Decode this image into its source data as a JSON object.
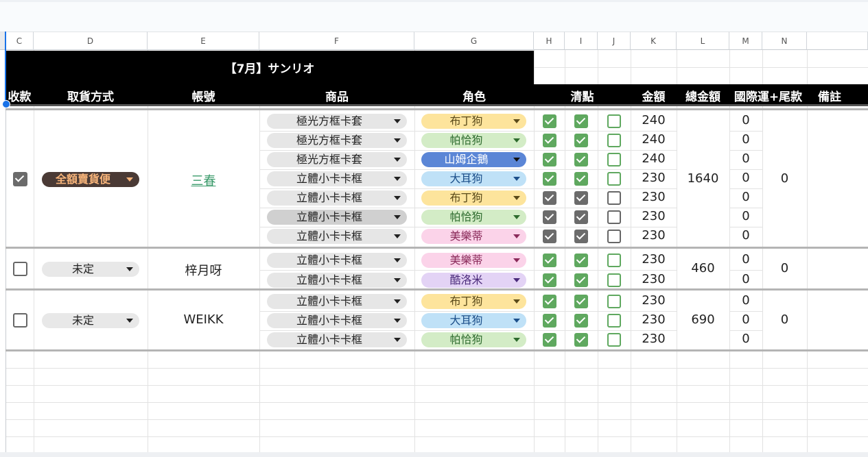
{
  "columns": [
    "C",
    "D",
    "E",
    "F",
    "G",
    "H",
    "I",
    "J",
    "K",
    "L",
    "M",
    "N"
  ],
  "header": {
    "title": "【7月】サンリオ",
    "labels": {
      "collect": "收款",
      "pickup": "取貨方式",
      "account": "帳號",
      "product": "商品",
      "role": "角色",
      "check": "清點",
      "amount": "金額",
      "total": "總金額",
      "intl": "國際運+尾款",
      "note": "備註"
    }
  },
  "colors": {
    "yellow": "#fde49c",
    "green": "#d3ecc6",
    "blue": "#5b86d6",
    "lightblue": "#bfe1f7",
    "pink": "#fbd3e9",
    "purple": "#e3d3f5",
    "product": "#e6e6e6",
    "product_dark": "#d0d0d0",
    "checkbox_green": "#5fa85f",
    "checkbox_gray": "#6b6b6b",
    "pickup_dark": "#4a3a35",
    "pickup_text": "#f7b47a"
  },
  "groups": [
    {
      "collected": true,
      "pickup": "全額賣貨便",
      "account": "三春",
      "total": "1640",
      "intl": "0",
      "rows": [
        {
          "product": "極光方框卡套",
          "role": "布丁狗",
          "role_color": "yellow",
          "text_color": "#5a4a1a",
          "h": true,
          "i": true,
          "j": false,
          "gray": false,
          "amount": "240",
          "m": "0"
        },
        {
          "product": "極光方框卡套",
          "role": "帕恰狗",
          "role_color": "green",
          "text_color": "#2e6b2e",
          "h": true,
          "i": true,
          "j": false,
          "gray": false,
          "amount": "240",
          "m": "0"
        },
        {
          "product": "極光方框卡套",
          "role": "山姆企鵝",
          "role_color": "blue",
          "text_color": "#ffffff",
          "h": true,
          "i": true,
          "j": false,
          "gray": false,
          "amount": "240",
          "m": "0"
        },
        {
          "product": "立體小卡卡框",
          "role": "大耳狗",
          "role_color": "lightblue",
          "text_color": "#1c4f8a",
          "h": true,
          "i": true,
          "j": false,
          "gray": false,
          "amount": "230",
          "m": "0"
        },
        {
          "product": "立體小卡卡框",
          "role": "布丁狗",
          "role_color": "yellow",
          "text_color": "#5a4a1a",
          "h": true,
          "i": true,
          "j": false,
          "gray": true,
          "amount": "230",
          "m": "0"
        },
        {
          "product": "立體小卡卡框",
          "role": "帕恰狗",
          "role_color": "green",
          "text_color": "#2e6b2e",
          "h": true,
          "i": true,
          "j": false,
          "gray": true,
          "amount": "230",
          "m": "0",
          "dark": true
        },
        {
          "product": "立體小卡卡框",
          "role": "美樂蒂",
          "role_color": "pink",
          "text_color": "#8a2a5a",
          "h": true,
          "i": true,
          "j": false,
          "gray": true,
          "amount": "230",
          "m": "0"
        }
      ]
    },
    {
      "collected": false,
      "pickup": "未定",
      "account": "梓月呀",
      "total": "460",
      "intl": "0",
      "rows": [
        {
          "product": "立體小卡卡框",
          "role": "美樂蒂",
          "role_color": "pink",
          "text_color": "#8a2a5a",
          "h": true,
          "i": true,
          "j": false,
          "gray": false,
          "amount": "230",
          "m": "0"
        },
        {
          "product": "立體小卡卡框",
          "role": "酷洛米",
          "role_color": "purple",
          "text_color": "#4a2a7a",
          "h": true,
          "i": true,
          "j": false,
          "gray": false,
          "amount": "230",
          "m": "0"
        }
      ]
    },
    {
      "collected": false,
      "pickup": "未定",
      "account": "WEIKK",
      "total": "690",
      "intl": "0",
      "rows": [
        {
          "product": "立體小卡卡框",
          "role": "布丁狗",
          "role_color": "yellow",
          "text_color": "#5a4a1a",
          "h": true,
          "i": true,
          "j": false,
          "gray": false,
          "amount": "230",
          "m": "0"
        },
        {
          "product": "立體小卡卡框",
          "role": "大耳狗",
          "role_color": "lightblue",
          "text_color": "#1c4f8a",
          "h": true,
          "i": true,
          "j": false,
          "gray": false,
          "amount": "230",
          "m": "0"
        },
        {
          "product": "立體小卡卡框",
          "role": "帕恰狗",
          "role_color": "green",
          "text_color": "#2e6b2e",
          "h": true,
          "i": true,
          "j": false,
          "gray": false,
          "amount": "230",
          "m": "0"
        }
      ]
    }
  ]
}
